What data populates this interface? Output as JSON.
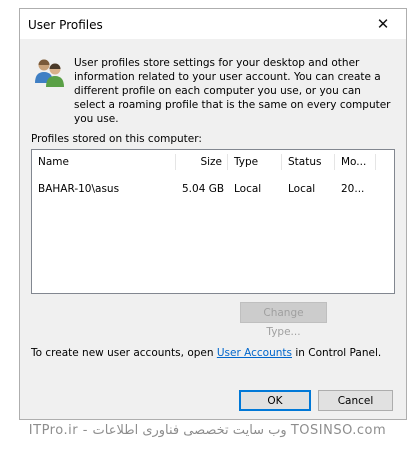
{
  "window": {
    "title": "User Profiles",
    "close_glyph": "✕"
  },
  "icons": {
    "users": "users-icon",
    "close": "close-icon"
  },
  "description": "User profiles store settings for your desktop and other information related to your user account. You can create a different profile on each computer you use, or you can select a roaming profile that is the same on every computer you use.",
  "profiles": {
    "label": "Profiles stored on this computer:",
    "columns": [
      "Name",
      "Size",
      "Type",
      "Status",
      "Mo..."
    ],
    "rows": [
      {
        "name": "BAHAR-10\\asus",
        "size": "5.04 GB",
        "type": "Local",
        "status": "Local",
        "modified": "20..."
      }
    ]
  },
  "buttons": {
    "change_type": "Change Type...",
    "ok": "OK",
    "cancel": "Cancel"
  },
  "create": {
    "prefix": "To create new user accounts, open ",
    "link": "User Accounts",
    "suffix": " in Control Panel."
  },
  "watermark": "ITPro.ir - وب سایت تخصصی فناوری اطلاعات  TOSINSO.com"
}
